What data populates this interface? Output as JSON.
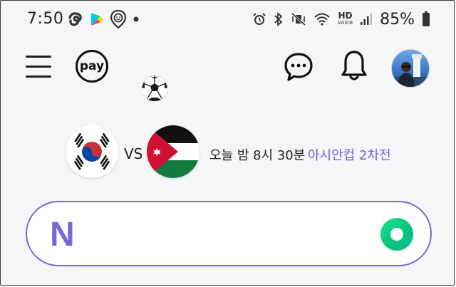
{
  "status_bar": {
    "time": "7:50",
    "battery": "85%",
    "hd_voice_hd": "HD",
    "hd_voice_voice": "voice",
    "left_icons": [
      "threads-icon",
      "play-store-icon",
      "location-face-icon",
      "dot-icon"
    ],
    "right_icons": [
      "alarm-icon",
      "bluetooth-icon",
      "vibrate-mute-icon",
      "wifi-icon",
      "signal-icon",
      "battery-icon"
    ]
  },
  "nav": {
    "pay_label": "pay",
    "icons": [
      "menu-icon",
      "chat-icon",
      "bell-icon",
      "avatar"
    ]
  },
  "match": {
    "vs": "VS",
    "time_text": "오늘 밤 8시 30분",
    "cup_text": "아시안컵 2차전",
    "team_left": "korea-flag",
    "team_right": "jordan-flag"
  },
  "search": {
    "logo": "N",
    "colors": {
      "accent": "#7a66d8",
      "green": "#0bc47a"
    }
  }
}
